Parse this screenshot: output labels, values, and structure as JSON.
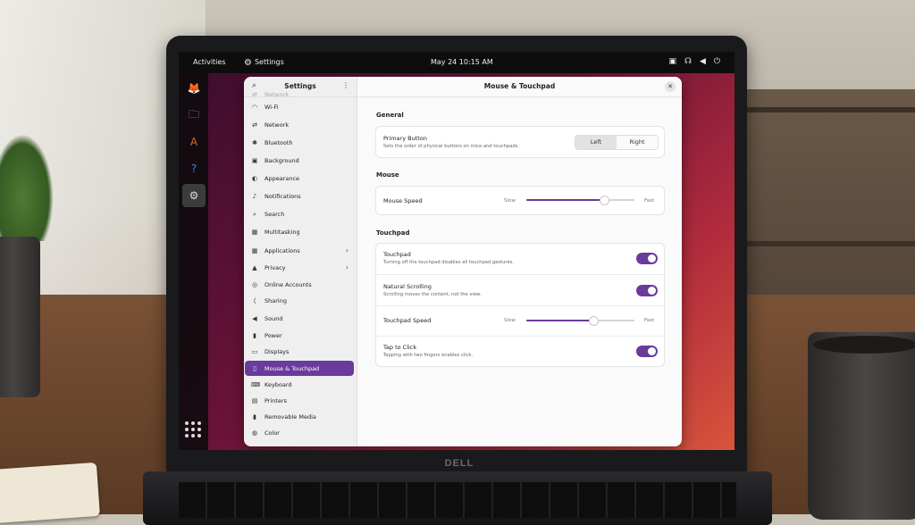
{
  "topbar": {
    "activities": "Activities",
    "app_name": "Settings",
    "clock": "May 24   10:15 AM",
    "status_icons": [
      "screen-icon",
      "accessibility-icon",
      "volume-icon",
      "power-icon"
    ]
  },
  "dock": {
    "items": [
      {
        "name": "firefox-icon",
        "glyph": "🦊"
      },
      {
        "name": "files-icon",
        "glyph": "🗀"
      },
      {
        "name": "app-center-icon",
        "glyph": "A"
      },
      {
        "name": "help-icon",
        "glyph": "?"
      },
      {
        "name": "settings-icon",
        "glyph": "⚙",
        "active": true
      }
    ]
  },
  "laptop_brand": "DELL",
  "sidebar": {
    "title": "Settings",
    "items": [
      {
        "label": "Network",
        "icon": "network-icon",
        "faded": true
      },
      {
        "label": "Wi-Fi",
        "icon": "wifi-icon"
      },
      {
        "label": "Network",
        "icon": "network-icon"
      },
      {
        "label": "Bluetooth",
        "icon": "bluetooth-icon"
      },
      {
        "label": "Background",
        "icon": "background-icon"
      },
      {
        "label": "Appearance",
        "icon": "appearance-icon"
      },
      {
        "label": "Notifications",
        "icon": "bell-icon"
      },
      {
        "label": "Search",
        "icon": "search-icon"
      },
      {
        "label": "Multitasking",
        "icon": "multitasking-icon"
      },
      {
        "label": "Applications",
        "icon": "applications-icon",
        "chevron": true
      },
      {
        "label": "Privacy",
        "icon": "lock-icon",
        "chevron": true
      },
      {
        "label": "Online Accounts",
        "icon": "accounts-icon"
      },
      {
        "label": "Sharing",
        "icon": "share-icon"
      },
      {
        "label": "Sound",
        "icon": "sound-icon"
      },
      {
        "label": "Power",
        "icon": "power-icon"
      },
      {
        "label": "Displays",
        "icon": "display-icon"
      },
      {
        "label": "Mouse & Touchpad",
        "icon": "mouse-icon",
        "selected": true
      },
      {
        "label": "Keyboard",
        "icon": "keyboard-icon"
      },
      {
        "label": "Printers",
        "icon": "printer-icon"
      },
      {
        "label": "Removable Media",
        "icon": "removable-media-icon"
      },
      {
        "label": "Color",
        "icon": "color-icon"
      }
    ]
  },
  "main": {
    "title": "Mouse & Touchpad",
    "general": {
      "section": "General",
      "primary_button": {
        "label": "Primary Button",
        "desc": "Sets the order of physical buttons on mice and touchpads.",
        "options": [
          "Left",
          "Right"
        ],
        "selected": "Left"
      }
    },
    "mouse": {
      "section": "Mouse",
      "speed": {
        "label": "Mouse Speed",
        "min_label": "Slow",
        "max_label": "Fast",
        "value": 0.72
      }
    },
    "touchpad": {
      "section": "Touchpad",
      "touchpad": {
        "label": "Touchpad",
        "desc": "Turning off the touchpad disables all touchpad gestures.",
        "on": true
      },
      "natural_scrolling": {
        "label": "Natural Scrolling",
        "desc": "Scrolling moves the content, not the view.",
        "on": true
      },
      "speed": {
        "label": "Touchpad Speed",
        "min_label": "Slow",
        "max_label": "Fast",
        "value": 0.62
      },
      "tap_to_click": {
        "label": "Tap to Click",
        "desc": "Tapping with two fingers enables click.",
        "on": true
      }
    }
  },
  "colors": {
    "accent": "#6a3a9c",
    "topbar": "#0d0d0d"
  }
}
